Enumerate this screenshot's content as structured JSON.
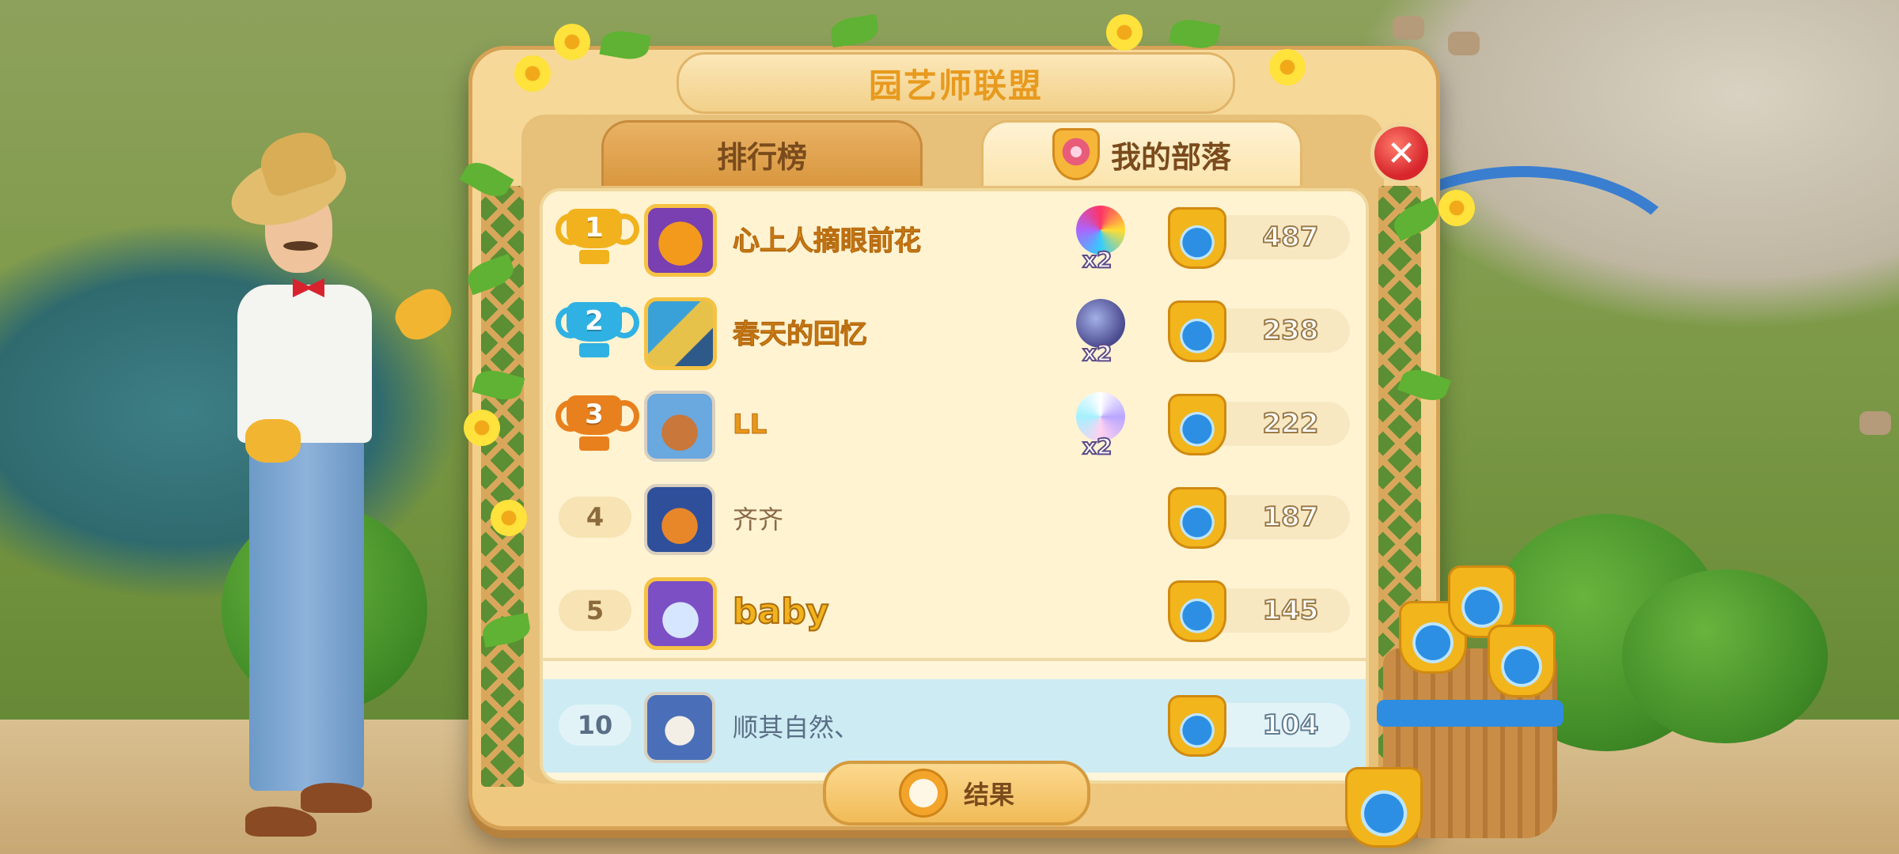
{
  "title": "园艺师联盟",
  "tabs": [
    {
      "label": "排行榜",
      "active": false
    },
    {
      "label": "我的部落",
      "active": true,
      "icon": "shield-flower-icon"
    }
  ],
  "close_label": "✕",
  "rows": [
    {
      "rank": "1",
      "rank_style": "gold-trophy",
      "name": "心上人摘眼前花",
      "name_style": "gold",
      "reward": "bomb-rocket",
      "reward_count": "x2",
      "score": "487"
    },
    {
      "rank": "2",
      "rank_style": "silver-trophy",
      "name": "春天的回忆",
      "name_style": "gold",
      "reward": "bombs",
      "reward_count": "x2",
      "score": "238"
    },
    {
      "rank": "3",
      "rank_style": "bronze-trophy",
      "name": "LL",
      "name_style": "gold",
      "reward": "rainbow-disc",
      "reward_count": "x2",
      "score": "222"
    },
    {
      "rank": "4",
      "rank_style": "plain",
      "name": "齐齐",
      "name_style": "plain",
      "score": "187"
    },
    {
      "rank": "5",
      "rank_style": "plain",
      "name": "baby",
      "name_style": "big-gold",
      "score": "145"
    }
  ],
  "self_row": {
    "rank": "10",
    "name": "顺其自然、",
    "score": "104"
  },
  "result_button": {
    "label": "结果",
    "icon": "alarm-clock-icon"
  },
  "colors": {
    "accent_gold": "#f1b21d",
    "silver": "#2fb2e3",
    "bronze": "#e7801d",
    "self_row": "#cdebf3",
    "close_red": "#d7262c"
  }
}
